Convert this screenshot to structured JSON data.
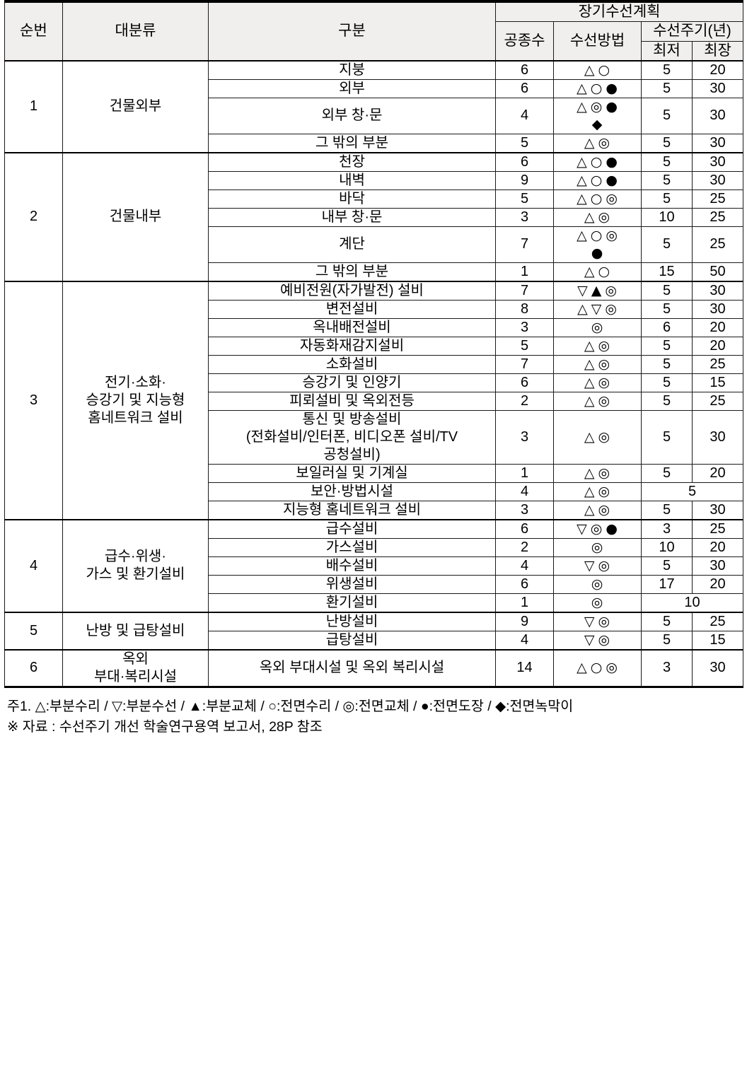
{
  "table": {
    "headers": {
      "seq": "순번",
      "major": "대분류",
      "division": "구분",
      "plan_group": "장기수선계획",
      "count": "공종수",
      "method": "수선방법",
      "cycle_group": "수선주기(년)",
      "min": "최저",
      "max": "최장"
    },
    "groups": [
      {
        "seq": "1",
        "major": "건물외부",
        "rows": [
          {
            "division": "지붕",
            "count": "6",
            "method": [
              "△ ○"
            ],
            "min": "5",
            "max": "20"
          },
          {
            "division": "외부",
            "count": "6",
            "method": [
              "△ ○ ●"
            ],
            "min": "5",
            "max": "30"
          },
          {
            "division": "외부 창·문",
            "count": "4",
            "method": [
              "△ ◎ ●",
              "◆"
            ],
            "min": "5",
            "max": "30"
          },
          {
            "division": "그 밖의 부분",
            "count": "5",
            "method": [
              "△ ◎"
            ],
            "min": "5",
            "max": "30"
          }
        ]
      },
      {
        "seq": "2",
        "major": "건물내부",
        "rows": [
          {
            "division": "천장",
            "count": "6",
            "method": [
              "△ ○ ●"
            ],
            "min": "5",
            "max": "30"
          },
          {
            "division": "내벽",
            "count": "9",
            "method": [
              "△ ○ ●"
            ],
            "min": "5",
            "max": "30"
          },
          {
            "division": "바닥",
            "count": "5",
            "method": [
              "△ ○ ◎"
            ],
            "min": "5",
            "max": "25"
          },
          {
            "division": "내부 창·문",
            "count": "3",
            "method": [
              "△ ◎"
            ],
            "min": "10",
            "max": "25"
          },
          {
            "division": "계단",
            "count": "7",
            "method": [
              "△ ○ ◎",
              "●"
            ],
            "min": "5",
            "max": "25"
          },
          {
            "division": "그 밖의 부분",
            "count": "1",
            "method": [
              "△ ○"
            ],
            "min": "15",
            "max": "50"
          }
        ]
      },
      {
        "seq": "3",
        "major": "전기·소화·\n승강기 및 지능형\n홈네트워크 설비",
        "rows": [
          {
            "division": "예비전원(자가발전) 설비",
            "count": "7",
            "method": [
              "▽ ▲ ◎"
            ],
            "min": "5",
            "max": "30"
          },
          {
            "division": "변전설비",
            "count": "8",
            "method": [
              "△ ▽ ◎"
            ],
            "min": "5",
            "max": "30"
          },
          {
            "division": "옥내배전설비",
            "count": "3",
            "method": [
              "◎"
            ],
            "min": "6",
            "max": "20"
          },
          {
            "division": "자동화재감지설비",
            "count": "5",
            "method": [
              "△ ◎"
            ],
            "min": "5",
            "max": "20"
          },
          {
            "division": "소화설비",
            "count": "7",
            "method": [
              "△ ◎"
            ],
            "min": "5",
            "max": "25"
          },
          {
            "division": "승강기 및 인양기",
            "count": "6",
            "method": [
              "△ ◎"
            ],
            "min": "5",
            "max": "15"
          },
          {
            "division": "피뢰설비 및 옥외전등",
            "count": "2",
            "method": [
              "△ ◎"
            ],
            "min": "5",
            "max": "25"
          },
          {
            "division": "통신 및 방송설비\n(전화설비/인터폰, 비디오폰 설비/TV\n공청설비)",
            "count": "3",
            "method": [
              "△ ◎"
            ],
            "min": "5",
            "max": "30"
          },
          {
            "division": "보일러실 및 기계실",
            "count": "1",
            "method": [
              "△ ◎"
            ],
            "min": "5",
            "max": "20"
          },
          {
            "division": "보안·방법시설",
            "count": "4",
            "method": [
              "△ ◎"
            ],
            "cycle_merged": "5"
          },
          {
            "division": "지능형 홈네트워크 설비",
            "count": "3",
            "method": [
              "△ ◎"
            ],
            "min": "5",
            "max": "30"
          }
        ]
      },
      {
        "seq": "4",
        "major": "급수·위생·\n가스 및 환기설비",
        "rows": [
          {
            "division": "급수설비",
            "count": "6",
            "method": [
              "▽ ◎ ●"
            ],
            "min": "3",
            "max": "25"
          },
          {
            "division": "가스설비",
            "count": "2",
            "method": [
              "◎"
            ],
            "min": "10",
            "max": "20"
          },
          {
            "division": "배수설비",
            "count": "4",
            "method": [
              "▽ ◎"
            ],
            "min": "5",
            "max": "30"
          },
          {
            "division": "위생설비",
            "count": "6",
            "method": [
              "◎"
            ],
            "min": "17",
            "max": "20"
          },
          {
            "division": "환기설비",
            "count": "1",
            "method": [
              "◎"
            ],
            "cycle_merged": "10"
          }
        ]
      },
      {
        "seq": "5",
        "major": "난방 및 급탕설비",
        "rows": [
          {
            "division": "난방설비",
            "count": "9",
            "method": [
              "▽ ◎"
            ],
            "min": "5",
            "max": "25"
          },
          {
            "division": "급탕설비",
            "count": "4",
            "method": [
              "▽ ◎"
            ],
            "min": "5",
            "max": "15"
          }
        ]
      },
      {
        "seq": "6",
        "major": "옥외\n부대·복리시설",
        "rows": [
          {
            "division": "옥외 부대시설 및 옥외 복리시설",
            "count": "14",
            "method": [
              "△ ○ ◎"
            ],
            "min": "3",
            "max": "30"
          }
        ]
      }
    ]
  },
  "notes": {
    "legend": "주1. △:부분수리 / ▽:부분수선 / ▲:부분교체 / ○:전면수리 / ◎:전면교체 / ●:전면도장 / ◆:전면녹막이",
    "source": "※ 자료 : 수선주기 개선 학술연구용역 보고서, 28P 참조"
  }
}
